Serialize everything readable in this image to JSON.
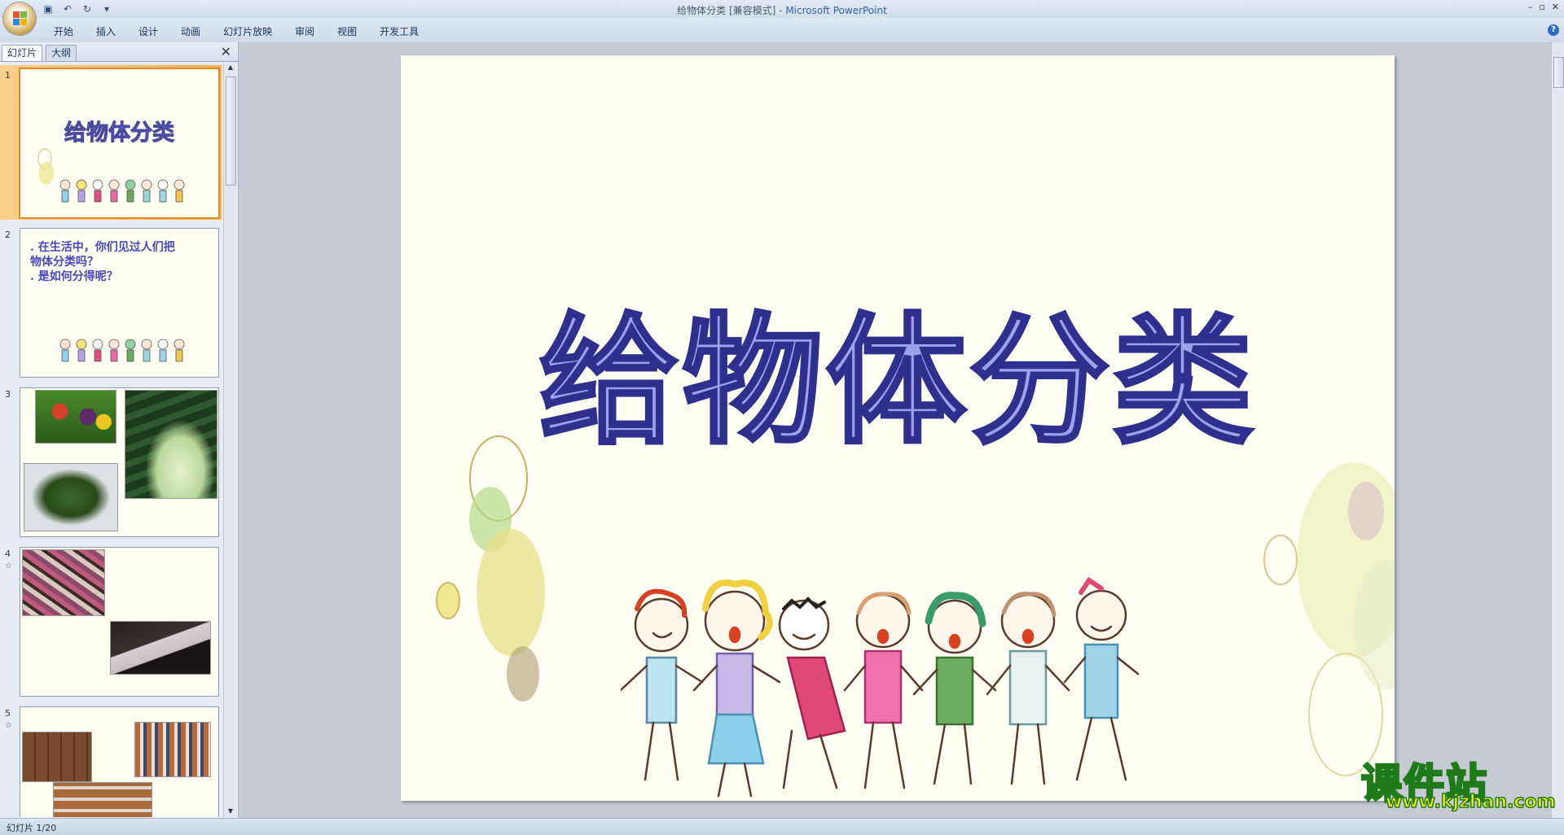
{
  "window": {
    "title": "给物体分类 [兼容模式]",
    "separator": " - ",
    "app_name": "Microsoft PowerPoint",
    "controls": [
      "–",
      "▫",
      "✕"
    ]
  },
  "ribbon": {
    "tabs": [
      "开始",
      "插入",
      "设计",
      "动画",
      "幻灯片放映",
      "审阅",
      "视图",
      "开发工具"
    ],
    "help": "?"
  },
  "left_pane": {
    "tabs": [
      "幻灯片",
      "大纲"
    ],
    "close": "✕",
    "thumbnails": [
      {
        "num": "1",
        "title": "给物体分类"
      },
      {
        "num": "2",
        "lines": [
          ". 在生活中，你们见过人们把",
          "物体分类吗？",
          ". 是如何分得呢？"
        ]
      },
      {
        "num": "3"
      },
      {
        "num": "4",
        "star": "☆"
      },
      {
        "num": "5",
        "star": "☆"
      }
    ]
  },
  "slide": {
    "title": "给物体分类"
  },
  "status": {
    "text": "幻灯片 1/20"
  },
  "watermark": {
    "main": "课件站",
    "url": "www.kjzhan.com"
  },
  "colors": {
    "slide_bg": "#fffef2",
    "title_fill": "#9fa0ee",
    "title_stroke": "#2f2f8e",
    "selection": "#f7b34d"
  }
}
